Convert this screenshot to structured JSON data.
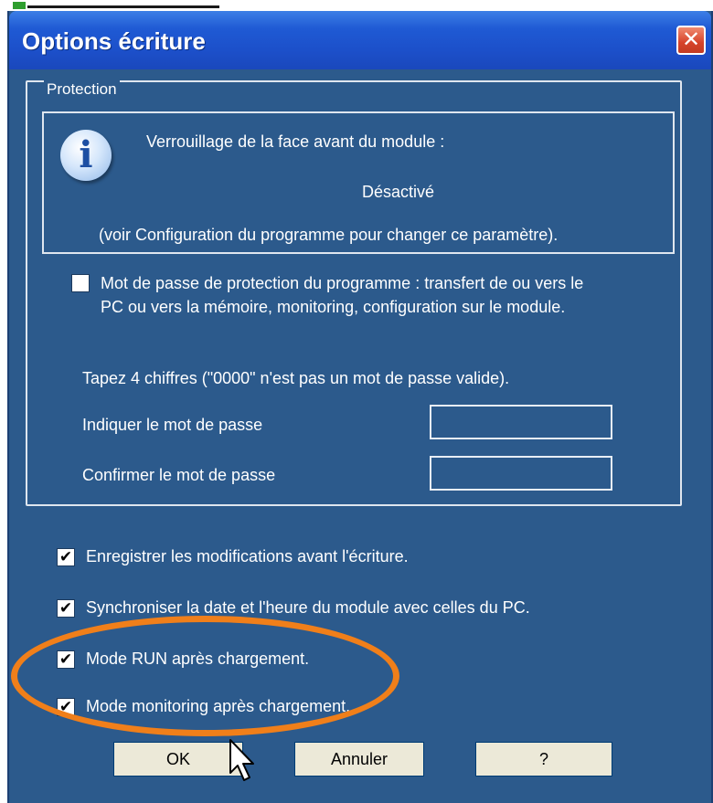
{
  "window": {
    "title": "Options écriture",
    "close_symbol": "✕"
  },
  "protection": {
    "legend": "Protection",
    "info": {
      "icon_name": "info-icon",
      "icon_glyph": "i",
      "line1": "Verrouillage de la face avant du module :",
      "status": "Désactivé",
      "hint": "(voir Configuration du programme pour changer ce paramètre)."
    },
    "password_checkbox": {
      "checked": false,
      "label_line1": "Mot de passe de protection du programme : transfert de ou vers le",
      "label_line2": "PC ou vers la mémoire, monitoring, configuration sur le module."
    },
    "instruction": "Tapez 4 chiffres (\"0000\" n'est pas un mot de passe valide).",
    "password_label": "Indiquer le mot de passe",
    "password_value": "",
    "confirm_label": "Confirmer le mot de passe",
    "confirm_value": ""
  },
  "options": [
    {
      "label": "Enregistrer les modifications avant l'écriture.",
      "checked": true,
      "mark": "✔"
    },
    {
      "label": "Synchroniser la date et l'heure du module avec celles du PC.",
      "checked": true,
      "mark": "✔"
    },
    {
      "label": "Mode RUN après chargement.",
      "checked": true,
      "mark": "✔"
    },
    {
      "label": "Mode monitoring après chargement.",
      "checked": true,
      "mark": "✔"
    }
  ],
  "buttons": {
    "ok": "OK",
    "cancel": "Annuler",
    "help": "?"
  },
  "annotation": {
    "shape": "ellipse",
    "color": "#f07f1a"
  },
  "colors": {
    "dialog_bg": "#2c5a8c",
    "titlebar": "#1f5ad4",
    "close": "#d6432a"
  }
}
